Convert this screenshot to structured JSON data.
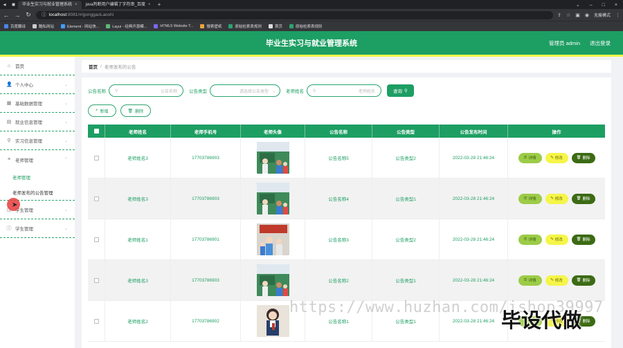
{
  "browser": {
    "tabs": [
      {
        "title": "毕业生实习与就业管理系统",
        "active": true
      },
      {
        "title": "java判断用户编辑了字符串_百度",
        "active": false
      }
    ],
    "url_host": "localhost",
    "url_path": ":8081/#/gonggaoLaoshi",
    "incognito_label": "无痕模式",
    "bookmarks": [
      "百度翻译",
      "酷私网站",
      "Element - 网站快...",
      "Layui - 经典开源模...",
      "HTML5 Website T...",
      "搜索壁纸",
      "原始检索表规则",
      "首页",
      "原始检索表规则"
    ]
  },
  "header": {
    "title": "毕业生实习与就业管理系统",
    "user": "管理员 admin",
    "logout": "退出登录"
  },
  "sidebar": {
    "items": [
      {
        "label": "首页",
        "icon": "home-icon"
      },
      {
        "label": "个人中心",
        "icon": "user-icon"
      },
      {
        "label": "基础数据管理",
        "icon": "grid-icon"
      },
      {
        "label": "就业信息管理",
        "icon": "briefcase-icon"
      },
      {
        "label": "实习信息管理",
        "icon": "pin-icon"
      },
      {
        "label": "老师管理",
        "icon": "list-icon"
      },
      {
        "label": "学生管理",
        "icon": "student-icon"
      },
      {
        "label": "学生管理",
        "icon": "info-icon"
      }
    ],
    "sub_items": [
      "老师管理",
      "老师发布的公告管理"
    ],
    "last_label": "学生管理"
  },
  "breadcrumb": {
    "home": "首页",
    "separator": "/",
    "current": "老师发布的公告"
  },
  "search": {
    "name_label": "公告名称",
    "name_placeholder": "公告名称",
    "type_label": "公告类型",
    "type_placeholder": "请选择公告类型",
    "teacher_label": "老师姓名",
    "teacher_placeholder": "老师姓名",
    "button": "查询"
  },
  "actions": {
    "add": "新增",
    "delete": "删除"
  },
  "table": {
    "headers": [
      "老师姓名",
      "老师手机号",
      "老师头像",
      "公告名称",
      "公告类型",
      "公告发布时间",
      "操作"
    ],
    "rows": [
      {
        "name": "老师姓名3",
        "phone": "17703786903",
        "title": "公告名称5",
        "type": "公告类型2",
        "time": "2022-03-28 21:46:24"
      },
      {
        "name": "老师姓名3",
        "phone": "17703786903",
        "title": "公告名称4",
        "type": "公告类型1",
        "time": "2022-03-28 21:46:24"
      },
      {
        "name": "老师姓名1",
        "phone": "17703786901",
        "title": "公告名称3",
        "type": "公告类型2",
        "time": "2022-03-28 21:46:24"
      },
      {
        "name": "老师姓名3",
        "phone": "17703786903",
        "title": "公告名称2",
        "type": "公告类型1",
        "time": "2022-03-28 21:46:24"
      },
      {
        "name": "老师姓名2",
        "phone": "17703786902",
        "title": "公告名称1",
        "type": "公告类型1",
        "time": "2022-03-28 21:46:24"
      }
    ],
    "op_detail": "详情",
    "op_edit": "修改",
    "op_delete": "删除"
  },
  "watermark": {
    "url": "https://www.huzhan.com/ishop39997",
    "badge": "毕设代做"
  },
  "colors": {
    "primary": "#1d9e63",
    "accent_yellow": "#f5f54a",
    "detail": "#9ccc48",
    "delete": "#3c6b14"
  }
}
